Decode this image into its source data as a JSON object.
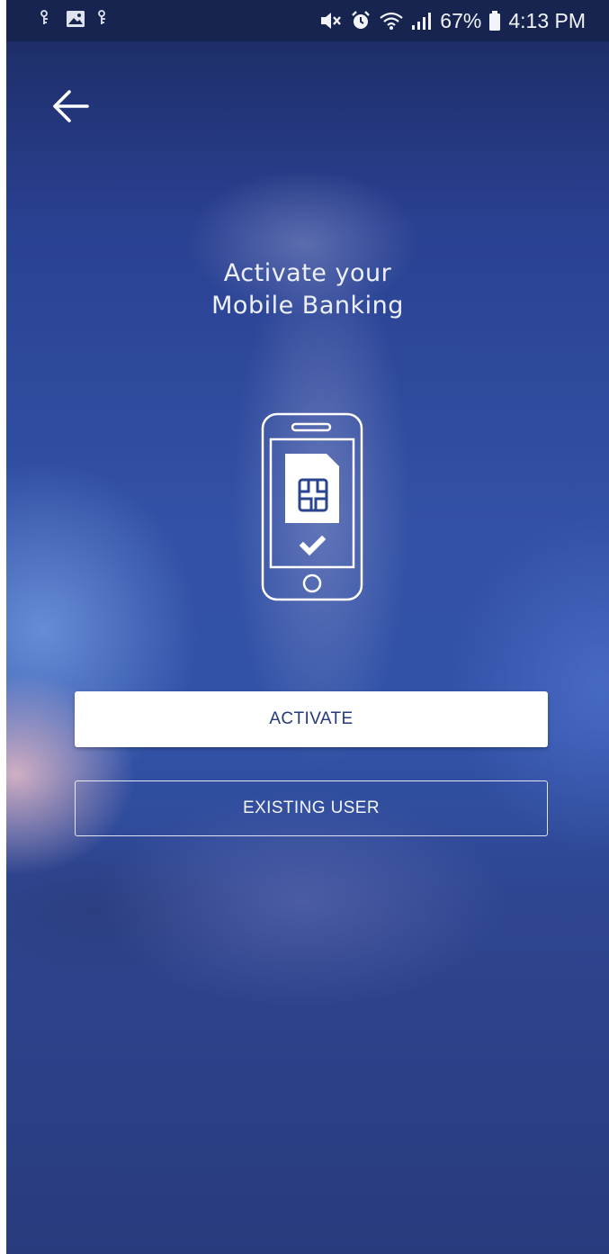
{
  "status_bar": {
    "battery": "67%",
    "time": "4:13 PM",
    "left_icons": [
      "notification-icon",
      "image-icon",
      "notification-icon"
    ],
    "right_icons": [
      "mute-icon",
      "alarm-icon",
      "wifi-icon",
      "signal-icon",
      "battery-icon"
    ]
  },
  "header": {
    "back_icon": "arrow-left-icon"
  },
  "title": {
    "line1": "Activate your",
    "line2": "Mobile Banking"
  },
  "illustration": {
    "icon": "phone-sim-check-icon"
  },
  "buttons": {
    "activate_label": "ACTIVATE",
    "existing_user_label": "EXISTING USER"
  },
  "colors": {
    "accent_text": "#253a7a",
    "background": "#3351a6"
  }
}
